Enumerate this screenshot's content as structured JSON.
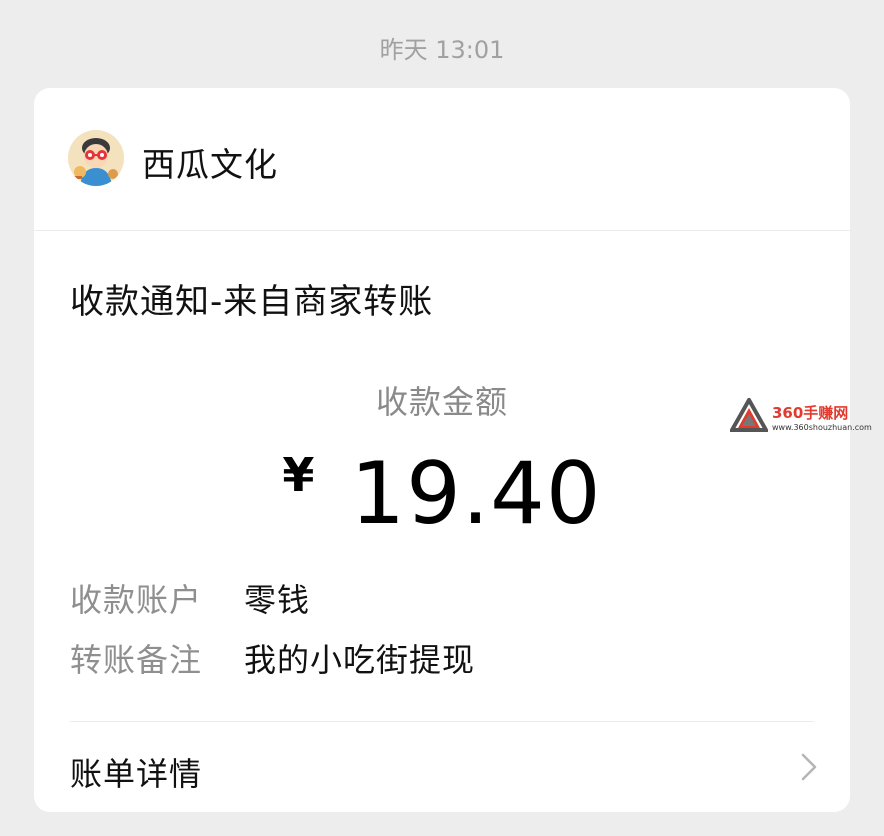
{
  "timestamp": "昨天 13:01",
  "merchant": {
    "name": "西瓜文化"
  },
  "notice": {
    "title": "收款通知-来自商家转账"
  },
  "amount": {
    "label": "收款金额",
    "currency": "¥",
    "value": "19.40"
  },
  "details": [
    {
      "label": "收款账户",
      "value": "零钱"
    },
    {
      "label": "转账备注",
      "value": "我的小吃街提现"
    }
  ],
  "bill": {
    "label": "账单详情"
  },
  "watermark": {
    "title": "360手赚网",
    "url": "www.360shouzhuan.com"
  },
  "colors": {
    "background": "#ededed",
    "card": "#ffffff",
    "primary_text": "#111111",
    "secondary_text": "#8f8f8f",
    "watermark_red": "#e23a2d"
  },
  "icons": {
    "avatar": "merchant-avatar",
    "chevron": "chevron-right-icon"
  }
}
